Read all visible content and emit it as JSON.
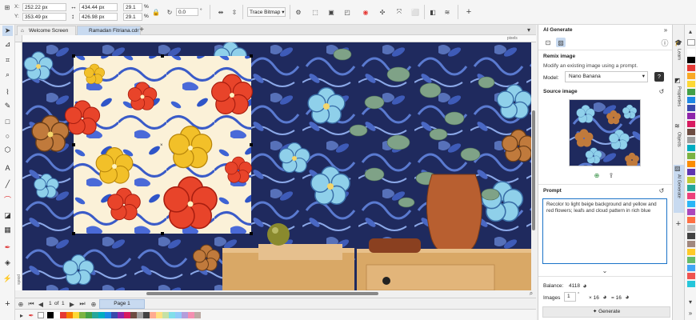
{
  "propbar": {
    "x_label": "X:",
    "x_value": "252.22 px",
    "y_label": "Y:",
    "y_value": "353.49 px",
    "w_value": "434.44 px",
    "h_value": "426.98 px",
    "sx_value": "29.1",
    "sy_value": "29.1",
    "pct": "%",
    "rotate_value": "0.0",
    "deg": "°",
    "trace_bitmap_label": "Trace Bitmap"
  },
  "tabs": [
    {
      "label": "Welcome Screen"
    },
    {
      "label": "Ramadan Fitriana.cdr"
    }
  ],
  "ruler": {
    "unit": "pixels"
  },
  "pagebar": {
    "page_current": "1",
    "page_of": "of",
    "page_total": "1",
    "page_tab": "Page 1"
  },
  "panel": {
    "title": "AI Generate",
    "section_title": "Remix image",
    "section_desc": "Modify an existing image using a prompt.",
    "model_label": "Model:",
    "model_value": "Nano Banana",
    "source_label": "Source image",
    "prompt_label": "Prompt",
    "prompt_text": "Recolor to light beige background and yellow and red flowers; leafs and cloud pattern in rich blue",
    "balance_label": "Balance:",
    "balance_value": "4118",
    "images_label": "Images",
    "images_value": "1",
    "images_mult": "× 16",
    "images_eq": "= 16",
    "generate_label": "Generate"
  },
  "dockers": [
    {
      "label": "Learn"
    },
    {
      "label": "Properties"
    },
    {
      "label": "Objects"
    },
    {
      "label": "AI Generate"
    }
  ],
  "colors": {
    "accent": "#1a73c8",
    "canvas_bg": "#1f2a5e",
    "beige": "#fbf1d8",
    "red_flower": "#e8442a",
    "yellow_flower": "#f2c029",
    "light_blue_flower": "#8fd0ea"
  },
  "swatch_colors": [
    "#ffffff",
    "#000000",
    "#e53935",
    "#f9a825",
    "#fdd835",
    "#43a047",
    "#1e88e5",
    "#3949ab",
    "#8e24aa",
    "#d81b60",
    "#6d4c41",
    "#9e9e9e",
    "#00acc1",
    "#7cb342",
    "#fb8c00",
    "#5e35b1",
    "#c0ca33",
    "#26a69a",
    "#ec407a",
    "#29b6f6",
    "#ab47bc",
    "#ff7043",
    "#bdbdbd",
    "#424242",
    "#a1887f",
    "#ffca28",
    "#66bb6a",
    "#42a5f5",
    "#ef5350",
    "#26c6da"
  ],
  "palette_colors": [
    "#000000",
    "#ffffff",
    "#e53935",
    "#f57c00",
    "#fdd835",
    "#7cb342",
    "#43a047",
    "#26a69a",
    "#00acc1",
    "#1e88e5",
    "#3949ab",
    "#8e24aa",
    "#d81b60",
    "#6d4c41",
    "#9e9e9e",
    "#424242",
    "#ffab91",
    "#ffe082",
    "#c5e1a5",
    "#80deea",
    "#90caf9",
    "#b39ddb",
    "#f48fb1",
    "#bcaaa4"
  ]
}
